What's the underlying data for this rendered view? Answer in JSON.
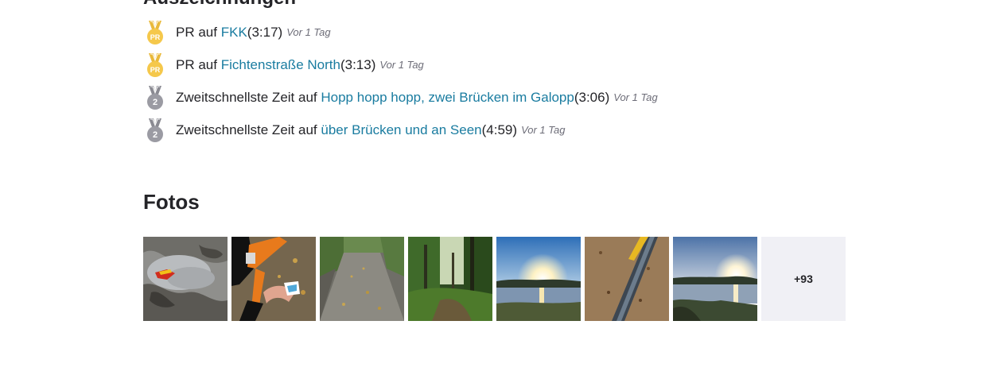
{
  "achievements_section": {
    "title": "Auszeichnungen",
    "items": [
      {
        "medal": "pr",
        "medal_label": "PR",
        "prefix": "PR auf ",
        "segment": "FKK",
        "time": " (3:17)",
        "ago": "Vor 1 Tag"
      },
      {
        "medal": "pr",
        "medal_label": "PR",
        "prefix": "PR auf ",
        "segment": "Fichtenstraße North",
        "time": " (3:13)",
        "ago": "Vor 1 Tag"
      },
      {
        "medal": "second",
        "medal_label": "2",
        "prefix": "Zweitschnellste Zeit auf ",
        "segment": "Hopp hopp hopp, zwei Brücken im Galopp",
        "time": " (3:06)",
        "ago": "Vor 1 Tag"
      },
      {
        "medal": "second",
        "medal_label": "2",
        "prefix": "Zweitschnellste Zeit auf ",
        "segment": "über Brücken und an Seen",
        "time": " (4:59)",
        "ago": "Vor 1 Tag"
      }
    ]
  },
  "photos_section": {
    "title": "Fotos",
    "more_label": "+93"
  },
  "colors": {
    "link": "#1a7ca0",
    "gold_medal": "#f5c84b",
    "silver_medal": "#9b9ba3",
    "more_tile_bg": "#f0f0f5"
  }
}
